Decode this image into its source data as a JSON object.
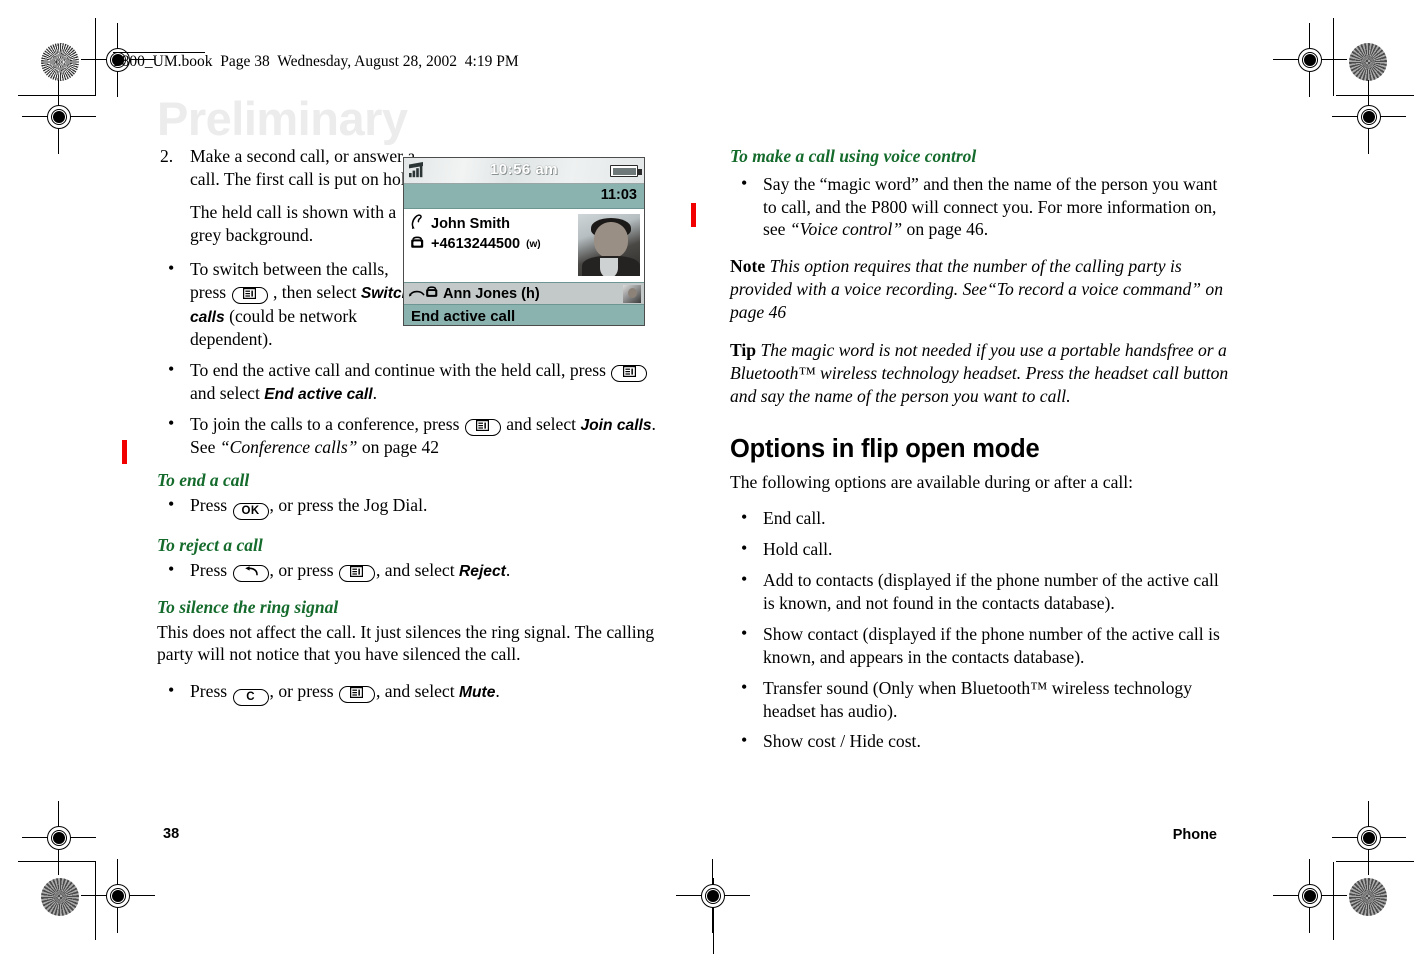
{
  "header": {
    "text": "P800_UM.book  Page 38  Wednesday, August 28, 2002  4:19 PM"
  },
  "watermark": {
    "text": "Preliminary"
  },
  "footer": {
    "page_number": "38",
    "chapter": "Phone"
  },
  "colors": {
    "heading_green": "#146b2c",
    "change_bar_red": "#f20000",
    "phone_teal": "#8ab3b0",
    "phone_held_grey": "#c3c9c9",
    "watermark_grey": "#ececec"
  },
  "left_column": {
    "step": {
      "number": "2.",
      "text": "Make a second call, or answer a call. The first call is put on hold.",
      "note": "The held call is shown with a grey background."
    },
    "bullets": [
      {
        "parts": [
          {
            "type": "text",
            "value": "To switch between the calls, press "
          },
          {
            "type": "key",
            "value": "menu-key"
          },
          {
            "type": "text",
            "value": " , then select "
          },
          {
            "type": "ui",
            "value": "Switch calls"
          },
          {
            "type": "text",
            "value": " (could be network dependent)."
          }
        ]
      },
      {
        "parts": [
          {
            "type": "text",
            "value": "To end the active call and continue with the held call, press "
          },
          {
            "type": "key",
            "value": "menu-key"
          },
          {
            "type": "text",
            "value": " and select "
          },
          {
            "type": "ui",
            "value": "End active call"
          },
          {
            "type": "text",
            "value": "."
          }
        ]
      },
      {
        "parts": [
          {
            "type": "text",
            "value": "To join the calls to a conference, press "
          },
          {
            "type": "key",
            "value": "menu-key"
          },
          {
            "type": "text",
            "value": " and select "
          },
          {
            "type": "ui",
            "value": "Join calls"
          },
          {
            "type": "text",
            "value": ". See "
          },
          {
            "type": "italic",
            "value": "“Conference calls”"
          },
          {
            "type": "text",
            "value": " on page 42"
          }
        ]
      }
    ],
    "sections": [
      {
        "heading": "To end a call",
        "bullet": {
          "pre": "Press ",
          "key": "OK",
          "post": ", or press the Jog Dial."
        }
      },
      {
        "heading": "To reject a call",
        "bullet": {
          "pre": "Press ",
          "key1": "back-key",
          "mid": ", or press ",
          "key2": "menu-key",
          "post": ", and select ",
          "ui": "Reject",
          "end": "."
        }
      },
      {
        "heading": "To silence the ring signal",
        "body": "This does not affect the call. It just silences the ring signal. The calling party will not notice that you have silenced the call.",
        "bullet": {
          "pre": "Press ",
          "key1": "C",
          "mid": ", or press ",
          "key2": "menu-key",
          "post": ", and select ",
          "ui": "Mute",
          "end": "."
        }
      }
    ]
  },
  "phone_screen": {
    "status_bar": {
      "signal_icon": "signal-bars-icon",
      "time": "10:56 am",
      "battery_icon": "battery-icon"
    },
    "call_timer": "11:03",
    "active_call": {
      "status_icon": "handset-active-icon",
      "name": "John Smith",
      "number_icon": "telephone-icon",
      "number": "+4613244500",
      "number_type": "(w)",
      "photo": "contact-photo"
    },
    "held_call": {
      "status_icon": "handset-held-icon",
      "number_icon": "telephone-icon",
      "label": "Ann Jones (h)",
      "thumbnail": "contact-thumbnail"
    },
    "soft_key": "End active call"
  },
  "right_column": {
    "voice_section": {
      "heading": "To make a call using voice control",
      "bullet": "Say the “magic word” and then the name of the person you want to call, and the P800 will connect you. For more information on, see ",
      "bullet_italic": "“Voice control”",
      "bullet_tail": " on page 46."
    },
    "note": {
      "label": "Note",
      "text": "This option requires that the number of the calling party is provided with a voice recording. See“To record a voice command” on page 46"
    },
    "tip": {
      "label": "Tip",
      "text": "The magic word is not needed if you use a portable handsfree or a Bluetooth™ wireless technology headset. Press the headset call button and say the name of the person you want to call."
    },
    "options": {
      "heading": "Options in flip open mode",
      "intro": "The following options are available during or after a call:",
      "items": [
        "End call.",
        "Hold call.",
        "Add to contacts (displayed if the phone number of the active call is known, and not found in the contacts database).",
        "Show contact (displayed if the phone number of the active call is known, and appears in the contacts database).",
        "Transfer sound (Only when Bluetooth™ wireless technology headset has audio).",
        "Show cost / Hide cost."
      ]
    }
  }
}
